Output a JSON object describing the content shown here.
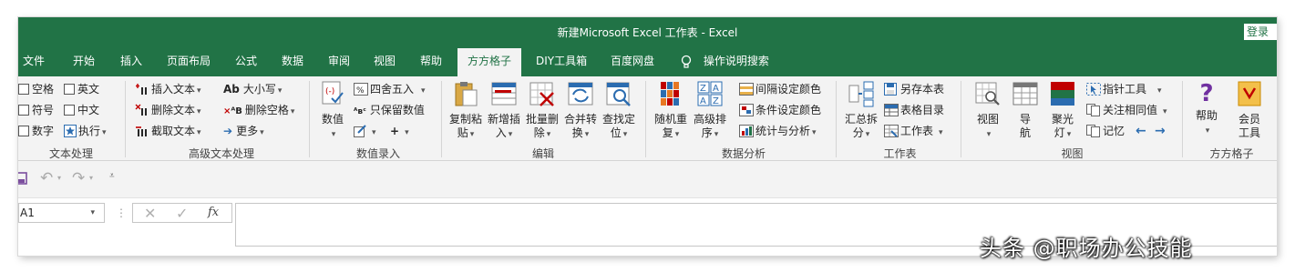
{
  "window": {
    "title": "新建Microsoft Excel 工作表  -  Excel",
    "login": "登录"
  },
  "tabs": [
    "文件",
    "开始",
    "插入",
    "页面布局",
    "公式",
    "数据",
    "审阅",
    "视图",
    "帮助",
    "方方格子",
    "DIY工具箱",
    "百度网盘",
    "操作说明搜索"
  ],
  "active_tab": "方方格子",
  "accent_color": "#217346",
  "groups": {
    "text": {
      "label": "文本处理",
      "items": [
        "空格",
        "英文",
        "符号",
        "中文",
        "数字",
        "执行"
      ]
    },
    "advanced_text": {
      "label": "高级文本处理",
      "items": [
        "插入文本",
        "删除文本",
        "截取文本",
        "大小写",
        "删除空格",
        "更多"
      ],
      "ab_prefix": "Ab",
      "ab_small_prefix": "ᴬB"
    },
    "value_entry": {
      "label": "数值录入",
      "numeric": "数值",
      "round": "四舍五入",
      "keep_values": "只保留数值",
      "abc_prefix": "ᴬʙᶜ"
    },
    "edit": {
      "label": "编辑",
      "buttons": [
        {
          "top": "复制粘",
          "bottom": "贴"
        },
        {
          "top": "新增插",
          "bottom": "入"
        },
        {
          "top": "批量删",
          "bottom": "除"
        },
        {
          "top": "合并转",
          "bottom": "换"
        },
        {
          "top": "查找定",
          "bottom": "位"
        }
      ]
    },
    "data_analysis": {
      "label": "数据分析",
      "buttons": [
        {
          "top": "随机重",
          "bottom": "复"
        },
        {
          "top": "高级排",
          "bottom": "序"
        }
      ],
      "items": [
        "间隔设定颜色",
        "条件设定颜色",
        "统计与分析"
      ]
    },
    "worksheet": {
      "label": "工作表",
      "summary_top": "汇总拆",
      "summary_bottom": "分",
      "items": [
        "另存本表",
        "表格目录",
        "工作表"
      ]
    },
    "view": {
      "label": "视图",
      "buttons": [
        {
          "top": "视图",
          "bottom": ""
        },
        {
          "top": "导",
          "bottom": "航"
        },
        {
          "top": "聚光",
          "bottom": "灯"
        }
      ],
      "items": [
        "指针工具",
        "关注相同值",
        "记忆"
      ]
    },
    "fangfang": {
      "label": "方方格子",
      "buttons": [
        {
          "top": "帮助",
          "bottom": ""
        },
        {
          "top": "会员",
          "bottom": "工具"
        }
      ]
    }
  },
  "formula_bar": {
    "name_box": "A1",
    "fx": "fx"
  },
  "watermark": "头条 @职场办公技能"
}
